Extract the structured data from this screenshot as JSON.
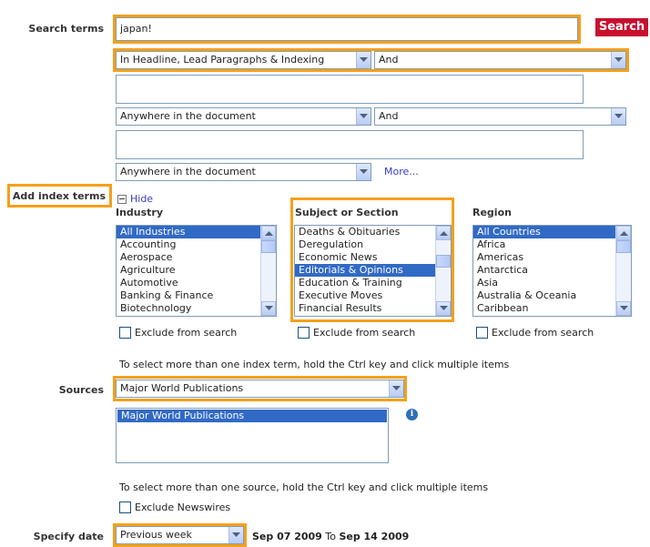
{
  "labels": {
    "search_terms": "Search terms",
    "add_index_terms": "Add index terms",
    "sources": "Sources",
    "specify_date": "Specify date"
  },
  "search": {
    "term1": "japan!",
    "term1_scope": "In Headline, Lead Paragraphs & Indexing",
    "operator1": "And",
    "term2": "",
    "term2_scope": "Anywhere in the document",
    "operator2": "And",
    "term3": "",
    "term3_scope": "Anywhere in the document",
    "more_link": "More...",
    "button": "Search"
  },
  "index": {
    "hide_label": "Hide",
    "hide_icon": "minus-box-icon",
    "industry": {
      "header": "Industry",
      "items": [
        "All Industries",
        "Accounting",
        "Aerospace",
        "Agriculture",
        "Automotive",
        "Banking & Finance",
        "Biotechnology"
      ],
      "selected": 0,
      "exclude": "Exclude from search"
    },
    "subject": {
      "header": "Subject or Section",
      "items": [
        "Deaths & Obituaries",
        "Deregulation",
        "Economic News",
        "Editorials & Opinions",
        "Education & Training",
        "Executive Moves",
        "Financial Results"
      ],
      "selected": 3,
      "exclude": "Exclude from search"
    },
    "region": {
      "header": "Region",
      "items": [
        "All Countries",
        "Africa",
        "Americas",
        "Antarctica",
        "Asia",
        "Australia & Oceania",
        "Caribbean"
      ],
      "selected": 0,
      "exclude": "Exclude from search"
    },
    "hint": "To select more than one index term, hold the Ctrl key and click multiple items"
  },
  "sources": {
    "dropdown": "Major World Publications",
    "list": [
      "Major World Publications"
    ],
    "hint": "To select more than one source, hold the Ctrl key and click multiple items",
    "exclude_newswires": "Exclude Newswires",
    "info_icon": "info-icon"
  },
  "date": {
    "range": "Previous week",
    "from": "Sep 07 2009",
    "to_word": "To",
    "to": "Sep 14 2009"
  },
  "colors": {
    "highlight": "#f5a01a",
    "search_button": "#c8102e",
    "selection": "#316ac5",
    "link": "#3b3bc4"
  }
}
